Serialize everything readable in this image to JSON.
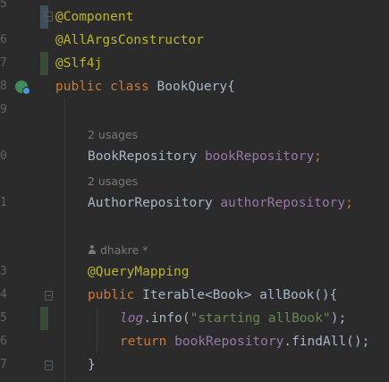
{
  "gutter": {
    "line_numbers": [
      "5",
      "6",
      "7",
      "8",
      "9",
      "0",
      "1",
      "3",
      "4",
      "5",
      "6",
      "7"
    ]
  },
  "code": {
    "l1": {
      "annotation": "@Component"
    },
    "l2": {
      "annotation": "@AllArgsConstructor"
    },
    "l3": {
      "annotation": "@Slf4j"
    },
    "l4": {
      "kw_public": "public",
      "kw_class": "class",
      "name": "BookQuery{"
    },
    "hint1": "2 usages",
    "l5": {
      "type": "BookRepository",
      "field": "bookRepository",
      "semi": ";"
    },
    "hint2": "2 usages",
    "l6": {
      "type": "AuthorRepository",
      "field": "authorRepository",
      "semi": ";"
    },
    "author_hint": "dhakre *",
    "l7": {
      "annotation": "@QueryMapping"
    },
    "l8": {
      "kw_public": "public",
      "type": "Iterable<Book>",
      "method": "allBook",
      "rest": "(){"
    },
    "l9": {
      "log": "log",
      "call": ".info(",
      "str": "\"starting allBook\"",
      "end": ");"
    },
    "l10": {
      "kw_return": "return",
      "field": "bookRepository",
      "call": ".findAll();"
    },
    "l11": {
      "brace": "}"
    }
  },
  "colors": {
    "background": "#2b2b2b",
    "annotation": "#bbb529",
    "keyword": "#cc7832",
    "field": "#9876aa",
    "string": "#6a8759",
    "default": "#a9b7c6"
  }
}
